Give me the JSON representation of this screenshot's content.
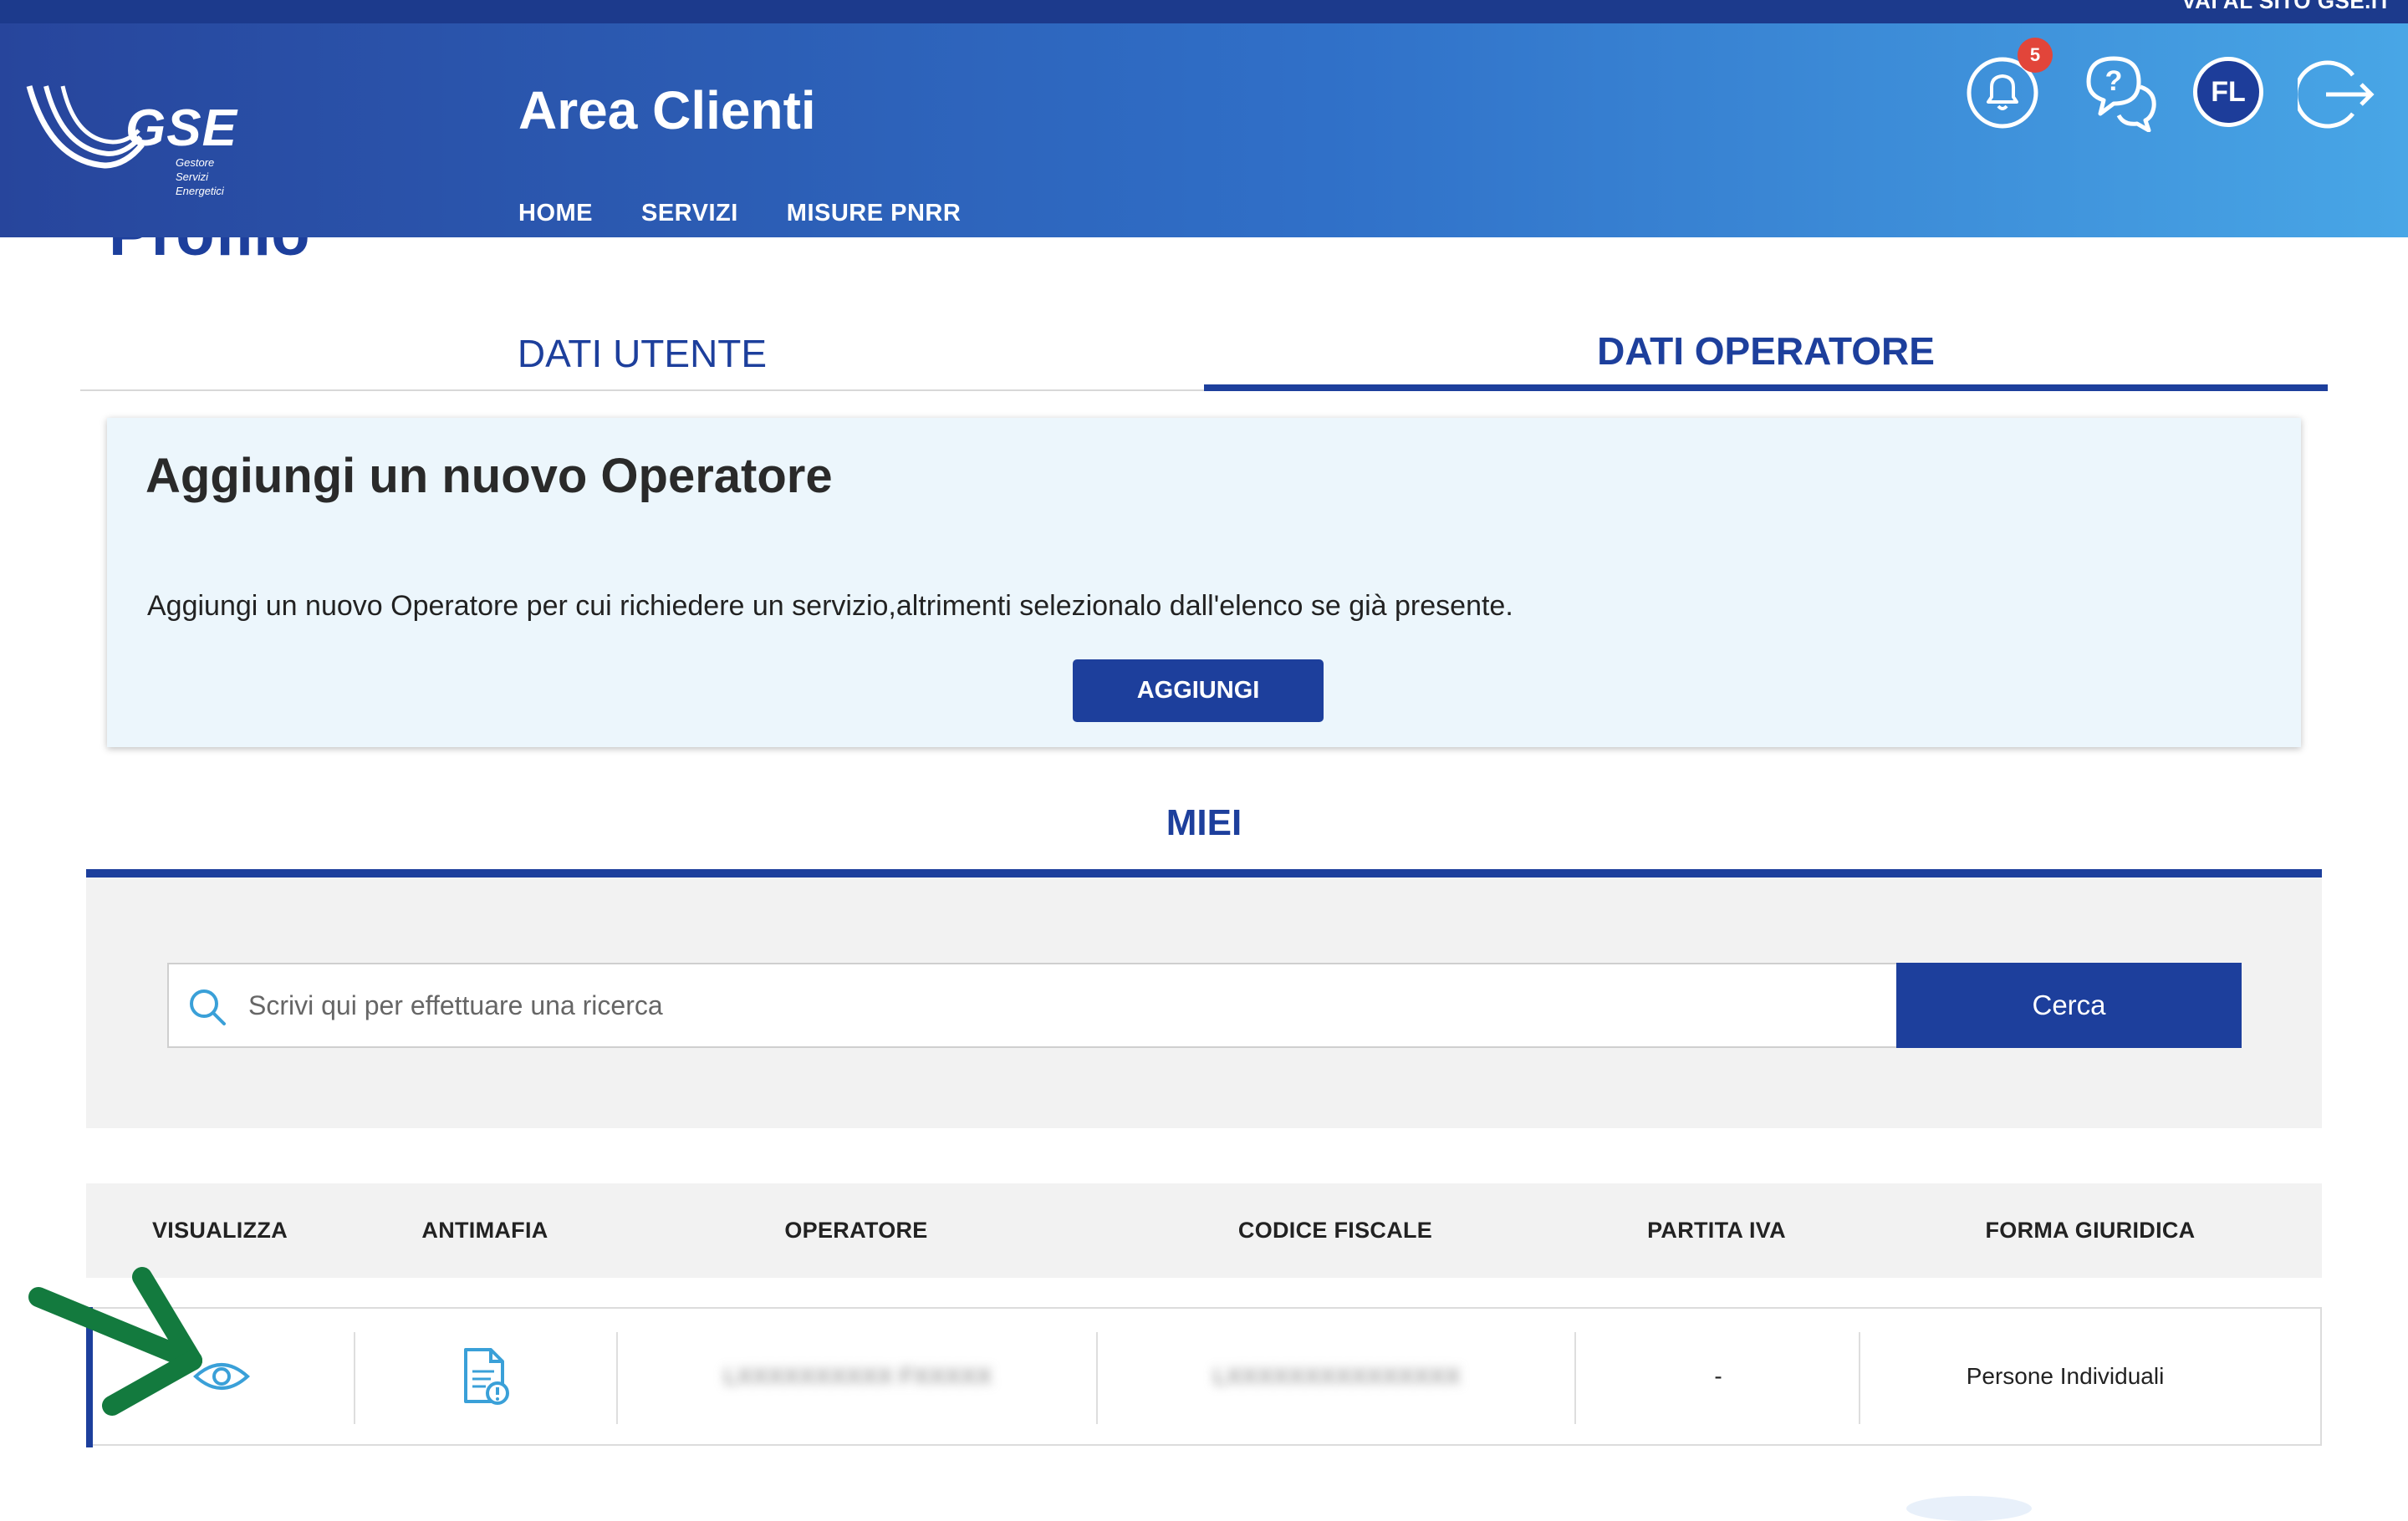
{
  "topbar": {
    "site_link": "VAI AL SITO GSE.IT"
  },
  "header": {
    "logo": {
      "brand": "GSE",
      "sub1": "Gestore",
      "sub2": "Servizi",
      "sub3": "Energetici"
    },
    "app_title": "Area Clienti",
    "nav": [
      "HOME",
      "SERVIZI",
      "MISURE PNRR"
    ],
    "notifications_count": "5",
    "avatar_initials": "FL",
    "icons": [
      "bell-icon",
      "help-chat-icon",
      "avatar",
      "logout-icon"
    ]
  },
  "page": {
    "title": "Profilo"
  },
  "tabs": [
    {
      "label": "DATI UTENTE",
      "active": false
    },
    {
      "label": "DATI OPERATORE",
      "active": true
    }
  ],
  "add_operator": {
    "title": "Aggiungi un nuovo Operatore",
    "description": "Aggiungi un nuovo Operatore per cui richiedere un servizio,altrimenti selezionalo dall'elenco se già presente.",
    "button": "AGGIUNGI"
  },
  "miei": {
    "title": "MIEI",
    "search_placeholder": "Scrivi qui per effettuare una ricerca",
    "search_button": "Cerca"
  },
  "table": {
    "headers": [
      "VISUALIZZA",
      "ANTIMAFIA",
      "OPERATORE",
      "CODICE FISCALE",
      "PARTITA IVA",
      "FORMA GIURIDICA"
    ],
    "rows": [
      {
        "operatore": "LXXXXXXXXXX FXXXXX",
        "codice_fiscale": "LXXXXXXXXXXXXXXX",
        "partita_iva": "-",
        "forma_giuridica": "Persone Individuali"
      }
    ]
  },
  "colors": {
    "primary": "#1d3f9c",
    "accent": "#48a6e6",
    "badge": "#e2453a",
    "arrow": "#137a3e"
  }
}
